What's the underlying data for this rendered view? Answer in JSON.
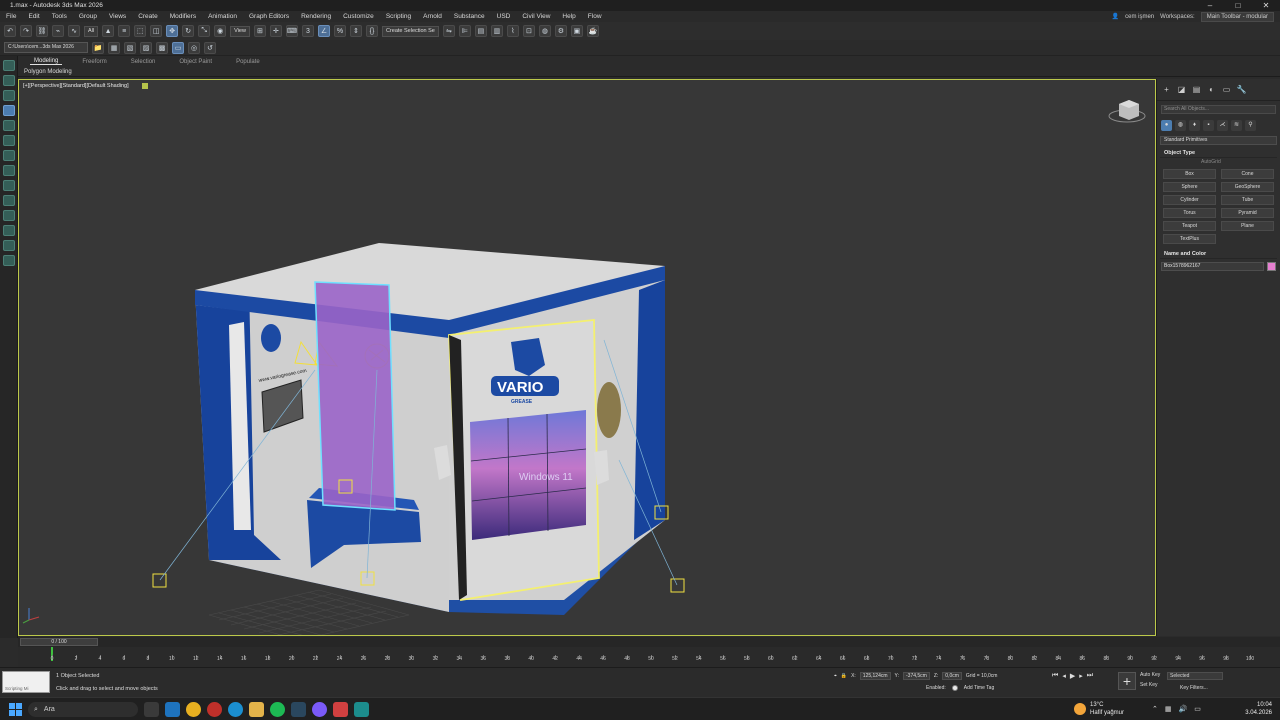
{
  "window": {
    "title": "1.max - Autodesk 3ds Max 2026",
    "controls": [
      "–",
      "□",
      "✕"
    ]
  },
  "menu": {
    "items": [
      "File",
      "Edit",
      "Tools",
      "Group",
      "Views",
      "Create",
      "Modifiers",
      "Animation",
      "Graph Editors",
      "Rendering",
      "Customize",
      "Scripting",
      "Arnold",
      "Substance",
      "USD",
      "Civil View",
      "Help",
      "Flow"
    ],
    "user": "cem işmen",
    "workspaces_label": "Workspaces:",
    "workspace": "Main Toolbar - modular"
  },
  "toolbar": {
    "filter": "All",
    "view": "View",
    "selection_set": "Create Selection Se"
  },
  "toolbar2": {
    "project_path": "C:\\Users\\cem...3ds Max 2026"
  },
  "ribbon": {
    "tabs": [
      "Modeling",
      "Freeform",
      "Selection",
      "Object Paint",
      "Populate"
    ],
    "sub": "Polygon Modeling"
  },
  "viewport": {
    "label": "[+][Perspective][Standard][Default Shading]"
  },
  "booth": {
    "brand": "VARIO",
    "brand_sub": "GREASE",
    "screen_text": "Windows 11",
    "wall_text": "www.variogrease.com"
  },
  "command_panel": {
    "search_placeholder": "Search All Objects...",
    "category": "Standard Primitives",
    "object_type_title": "Object Type",
    "autogrid": "AutoGrid",
    "buttons": [
      "Box",
      "Cone",
      "Sphere",
      "GeoSphere",
      "Cylinder",
      "Tube",
      "Torus",
      "Pyramid",
      "Teapot",
      "Plane",
      "TextPlus"
    ],
    "name_color_title": "Name and Color",
    "object_name": "Box1578962167",
    "object_color": "#e57fd0"
  },
  "timeline": {
    "slider": "0 / 100",
    "ticks": [
      "0",
      "2",
      "4",
      "6",
      "8",
      "10",
      "12",
      "14",
      "16",
      "18",
      "20",
      "22",
      "24",
      "26",
      "28",
      "30",
      "32",
      "34",
      "36",
      "38",
      "40",
      "42",
      "44",
      "46",
      "48",
      "50",
      "52",
      "54",
      "56",
      "58",
      "60",
      "62",
      "64",
      "66",
      "68",
      "70",
      "72",
      "74",
      "76",
      "78",
      "80",
      "82",
      "84",
      "86",
      "88",
      "90",
      "92",
      "94",
      "96",
      "98",
      "100"
    ]
  },
  "status": {
    "maxscript_label": "Scripting Mi",
    "selected": "1 Object Selected",
    "hint": "Click and drag to select and move objects",
    "x": "125,124cm",
    "y": "-374,5cm",
    "z": "0,0cm",
    "grid": "Grid = 10,0cm",
    "enabled": "Enabled:",
    "add_time_tag": "Add Time Tag",
    "frame": "0",
    "auto_key": "Auto Key",
    "set_key": "Set Key",
    "key_selected": "Selected",
    "key_filters": "Key Filters..."
  },
  "taskbar": {
    "search": "Ara",
    "weather_temp": "13°C",
    "weather_desc": "Hafif yağmur",
    "time": "10:04",
    "date": "3.04.2026"
  }
}
